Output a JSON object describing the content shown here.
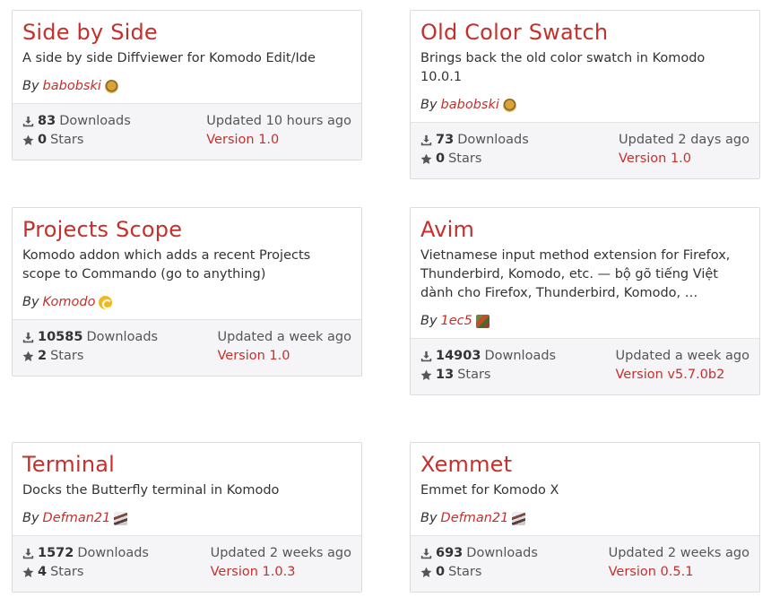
{
  "addons": [
    {
      "title": "Side by Side",
      "description": "A side by side Diffviewer for Komodo Edit/Ide",
      "by_label": "By",
      "author": "babobski",
      "avatar": "babobski-avatar",
      "downloads": "83",
      "downloads_label": "Downloads",
      "stars": "0",
      "stars_label": "Stars",
      "updated": "Updated 10 hours ago",
      "version": "Version 1.0"
    },
    {
      "title": "Old Color Swatch",
      "description": "Brings back the old color swatch in Komodo 10.0.1",
      "by_label": "By",
      "author": "babobski",
      "avatar": "babobski-avatar",
      "downloads": "73",
      "downloads_label": "Downloads",
      "stars": "0",
      "stars_label": "Stars",
      "updated": "Updated 2 days ago",
      "version": "Version 1.0"
    },
    {
      "title": "Projects Scope",
      "description": "Komodo addon which adds a recent Projects scope to Commando (go to anything)",
      "by_label": "By",
      "author": "Komodo",
      "avatar": "komodo-avatar",
      "downloads": "10585",
      "downloads_label": "Downloads",
      "stars": "2",
      "stars_label": "Stars",
      "updated": "Updated a week ago",
      "version": "Version 1.0"
    },
    {
      "title": "Avim",
      "description": "Vietnamese input method extension for Firefox, Thunderbird, Komodo, etc. — bộ gõ tiếng Việt dành cho Firefox, Thunderbird, Komodo, …",
      "by_label": "By",
      "author": "1ec5",
      "avatar": "1ec5-avatar",
      "downloads": "14903",
      "downloads_label": "Downloads",
      "stars": "13",
      "stars_label": "Stars",
      "updated": "Updated a week ago",
      "version": "Version v5.7.0b2"
    },
    {
      "title": "Terminal",
      "description": "Docks the Butterfly terminal in Komodo",
      "by_label": "By",
      "author": "Defman21",
      "avatar": "defman21-avatar",
      "downloads": "1572",
      "downloads_label": "Downloads",
      "stars": "4",
      "stars_label": "Stars",
      "updated": "Updated 2 weeks ago",
      "version": "Version 1.0.3"
    },
    {
      "title": "Xemmet",
      "description": "Emmet for Komodo X",
      "by_label": "By",
      "author": "Defman21",
      "avatar": "defman21-avatar",
      "downloads": "693",
      "downloads_label": "Downloads",
      "stars": "0",
      "stars_label": "Stars",
      "updated": "Updated 2 weeks ago",
      "version": "Version 0.5.1"
    }
  ],
  "colors": {
    "accent": "#c4302b",
    "footer_bg": "#f5f5f7",
    "border": "#dcdcdc"
  },
  "icons": {
    "downloads": "download-icon",
    "stars": "star-icon"
  }
}
